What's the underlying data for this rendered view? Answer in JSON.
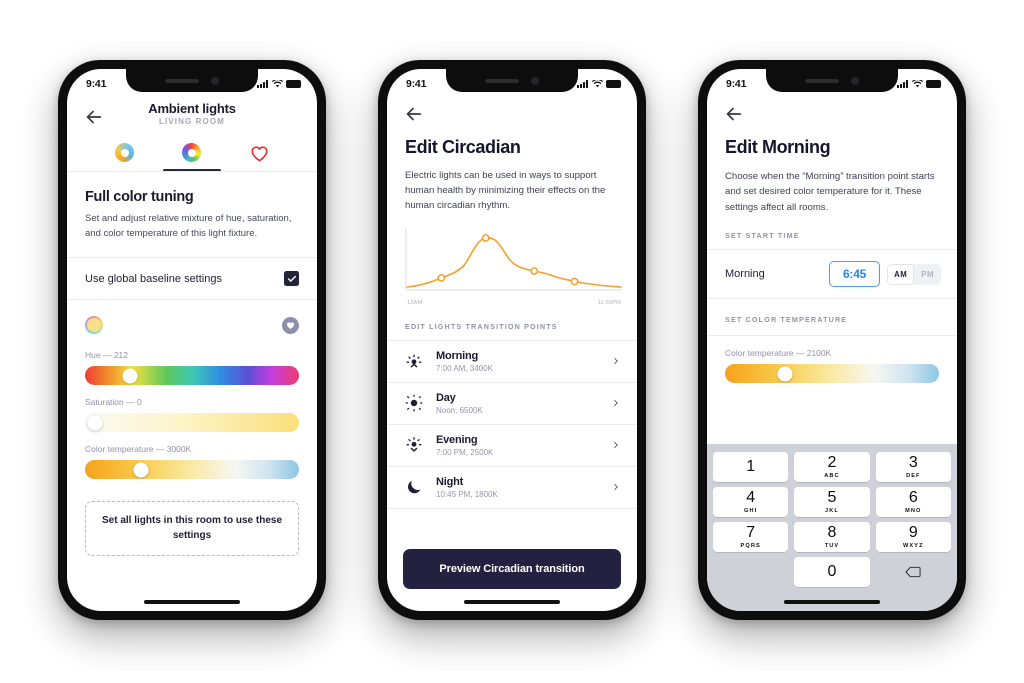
{
  "phone1": {
    "status": {
      "time": "9:41",
      "signal_icon": "cellular-bars-icon",
      "wifi_icon": "wifi-icon",
      "battery_icon": "battery-icon"
    },
    "nav": {
      "back_icon": "back-arrow-icon",
      "title": "Ambient lights",
      "subtitle": "LIVING ROOM"
    },
    "tabs": [
      {
        "name": "white-balance",
        "icon": "white-balance-ring-icon",
        "selected": false
      },
      {
        "name": "full-color",
        "icon": "color-wheel-ring-icon",
        "selected": true
      },
      {
        "name": "favorites",
        "icon": "heart-outline-icon",
        "selected": false
      }
    ],
    "heading": "Full color tuning",
    "description": "Set and adjust relative mixture of hue, saturation, and color temperature of this light fixture.",
    "toggle_row": {
      "label": "Use global baseline settings",
      "checked": true,
      "check_icon": "checkmark-icon"
    },
    "swatch_row": {
      "swatch_icon": "current-color-swatch",
      "favorite_icon": "heart-filled-icon"
    },
    "sliders": [
      {
        "name": "hue",
        "label": "Hue — 212",
        "value": 212,
        "knob_pct": 21
      },
      {
        "name": "saturation",
        "label": "Saturation — 0",
        "value": 0,
        "knob_pct": 4
      },
      {
        "name": "color-temperature",
        "label": "Color temperature — 3000K",
        "value": "3000K",
        "knob_pct": 26
      }
    ],
    "apply_button": "Set all lights in this room to use these settings"
  },
  "phone2": {
    "status": {
      "time": "9:41"
    },
    "nav": {
      "back_icon": "back-arrow-icon"
    },
    "title": "Edit Circadian",
    "description": "Electric lights can be used in ways to support human health by minimizing their effects on the human circadian rhythm.",
    "section_label": "EDIT LIGHTS TRANSITION POINTS",
    "transition_points": [
      {
        "icon": "sunrise-icon",
        "name": "Morning",
        "meta": "7:00 AM, 3400K",
        "chevron": "chevron-right-icon"
      },
      {
        "icon": "sun-icon",
        "name": "Day",
        "meta": "Noon, 6500K",
        "chevron": "chevron-right-icon"
      },
      {
        "icon": "sunset-icon",
        "name": "Evening",
        "meta": "7:00 PM, 2500K",
        "chevron": "chevron-right-icon"
      },
      {
        "icon": "moon-icon",
        "name": "Night",
        "meta": "10:45 PM, 1800K",
        "chevron": "chevron-right-icon"
      }
    ],
    "preview_button": "Preview Circadian transition",
    "chart_data": {
      "type": "line",
      "title": "",
      "xlabel": "",
      "ylabel": "",
      "x_tick_labels": [
        "12AM",
        "11:59PM"
      ],
      "grid": false,
      "legend": false,
      "line_color": "#f5a02a",
      "axis_color": "#dcdde4",
      "x": [
        0,
        1,
        2,
        3,
        4,
        5,
        6,
        7,
        8,
        9,
        10
      ],
      "values": [
        6,
        8,
        14,
        30,
        62,
        70,
        48,
        36,
        33,
        22,
        14
      ],
      "markers": [
        {
          "label": "Morning",
          "x": 2,
          "y": 14
        },
        {
          "label": "Day",
          "x": 4,
          "y": 62
        },
        {
          "label": "Evening",
          "x": 7,
          "y": 36
        },
        {
          "label": "Night",
          "x": 9,
          "y": 22
        }
      ],
      "ylim": [
        0,
        80
      ]
    }
  },
  "phone3": {
    "status": {
      "time": "9:41"
    },
    "nav": {
      "back_icon": "back-arrow-icon"
    },
    "title": "Edit Morning",
    "description": "Choose when the “Morning” transition point starts and set desired color temperature for it. These settings affect all rooms.",
    "start_time_label": "SET START TIME",
    "time_row": {
      "label": "Morning",
      "value": "6:45",
      "am": "AM",
      "pm": "PM",
      "selected_meridiem": "AM"
    },
    "color_temp_label": "SET COLOR TEMPERATURE",
    "color_temp_slider": {
      "label": "Color temperature — 2100K",
      "value": "2100K",
      "knob_pct": 28
    },
    "keypad": [
      [
        {
          "num": "1",
          "ltr": ""
        },
        {
          "num": "2",
          "ltr": "ABC"
        },
        {
          "num": "3",
          "ltr": "DEF"
        }
      ],
      [
        {
          "num": "4",
          "ltr": "GHI"
        },
        {
          "num": "5",
          "ltr": "JKL"
        },
        {
          "num": "6",
          "ltr": "MNO"
        }
      ],
      [
        {
          "num": "7",
          "ltr": "PQRS"
        },
        {
          "num": "8",
          "ltr": "TUV"
        },
        {
          "num": "9",
          "ltr": "WXYZ"
        }
      ],
      [
        {
          "num": "",
          "ltr": "",
          "blank": true
        },
        {
          "num": "0",
          "ltr": ""
        },
        {
          "num": "",
          "ltr": "",
          "delete_icon": "backspace-icon"
        }
      ]
    ]
  },
  "colors": {
    "accent_orange": "#f5a02a",
    "accent_blue": "#2a87e8",
    "dark_navy": "#222240",
    "heart_red": "#ec2b30",
    "muted_text": "#9093a8"
  }
}
